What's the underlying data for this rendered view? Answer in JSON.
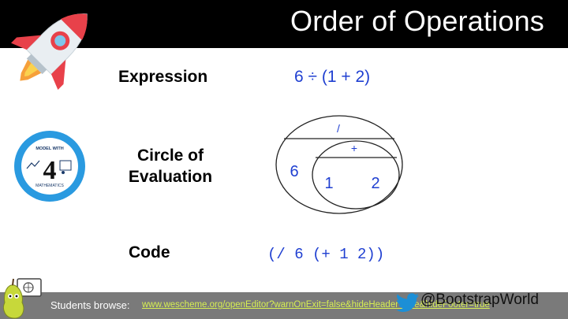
{
  "slide": {
    "title": "Order of Operations",
    "rows": {
      "expression": {
        "label": "Expression",
        "value": "6 ÷ (1 + 2)"
      },
      "circle": {
        "label_line1": "Circle of",
        "label_line2": "Evaluation",
        "outer_operator": "/",
        "outer_left": "6",
        "inner_operator": "+",
        "inner_left": "1",
        "inner_right": "2"
      },
      "code": {
        "label": "Code",
        "value": "(/ 6 (+ 1 2))"
      }
    }
  },
  "badge": {
    "top_text": "MODEL WITH",
    "number": "4",
    "bottom_text": "MATHEMATICS"
  },
  "footer": {
    "label": "Students browse:",
    "link": "www.wescheme.org/openEditor?warnOnExit=false&hideHeader=true&hideFooter=true",
    "handle": "@BootstrapWorld"
  },
  "colors": {
    "title_bar": "#000000",
    "footer_bar": "#7a7a7a",
    "accent_blue": "#1f3fd1",
    "badge_blue": "#2a9ae0",
    "link_yellow": "#d7ef52"
  },
  "icons": [
    "rocket-icon",
    "model-with-mathematics-badge",
    "pear-icon",
    "twitter-bird-icon"
  ]
}
